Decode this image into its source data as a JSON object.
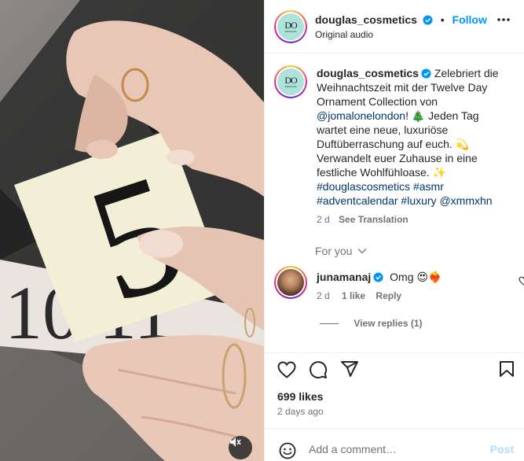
{
  "header": {
    "username": "douglas_cosmetics",
    "separator": "•",
    "follow_label": "Follow",
    "subtitle": "Original audio",
    "avatar_monogram": "DO",
    "avatar_brand": "DOUGLAS"
  },
  "caption": {
    "username": "douglas_cosmetics",
    "text_1": "Zelebriert die Weihnachtszeit mit der Twelve Day Ornament Collection von",
    "mention": "@jomalonelondon",
    "text_2": "! 🎄 Jeden Tag wartet eine neue, luxuriöse Duftüberraschung auf euch. 💫 Verwandelt euer Zuhause in eine festliche Wohlfühloase. ✨",
    "hashtags": [
      "#douglascosmetics",
      "#asmr",
      "#adventcalendar",
      "#luxury",
      "@xmmxhn"
    ],
    "age": "2 d",
    "see_translation": "See Translation"
  },
  "for_you_label": "For you",
  "comment": {
    "username": "junamanaj",
    "text": "Omg 😍❤️‍🔥",
    "age": "2 d",
    "likes": "1 like",
    "reply": "Reply",
    "view_replies": "View replies (1)"
  },
  "stats": {
    "likes": "699 likes",
    "ago": "2 days ago"
  },
  "comment_bar": {
    "placeholder": "Add a comment…",
    "post_label": "Post"
  },
  "media": {
    "big_number": "5",
    "background_numbers": "10 11"
  },
  "colors": {
    "accent": "#0095f6",
    "link": "#00376b",
    "muted": "#737373",
    "avatar_teal": "#aee3dc"
  }
}
